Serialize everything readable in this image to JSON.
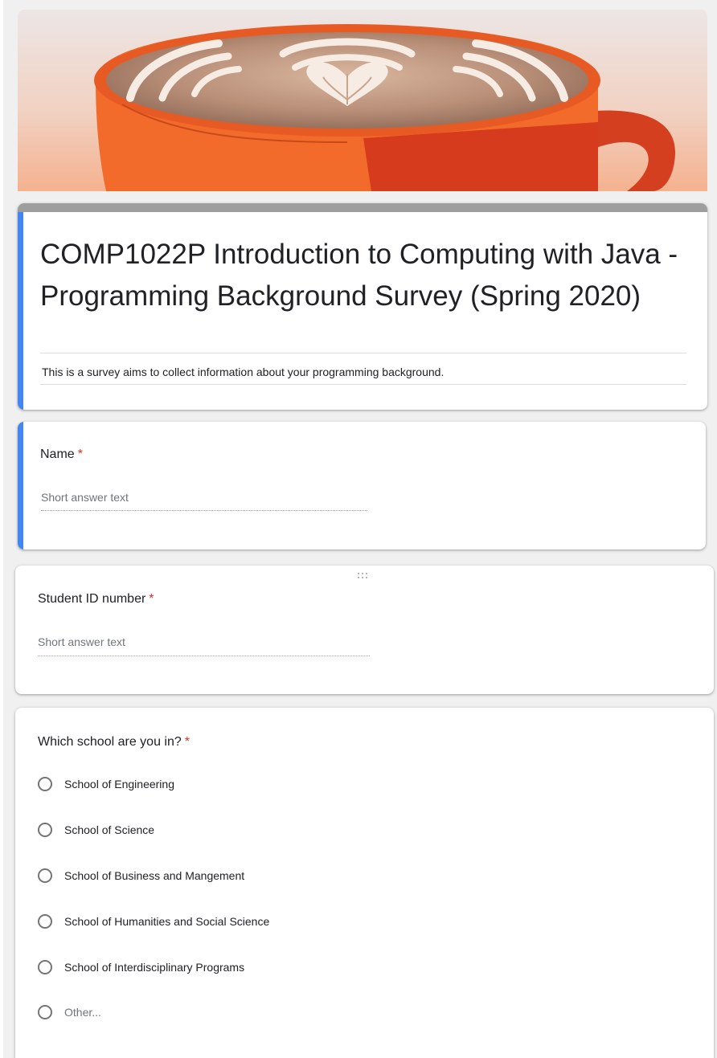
{
  "form": {
    "title": "COMP1022P Introduction to Computing with Java - Programming Background Survey (Spring 2020)",
    "description": "This is a survey aims to collect information about your programming background."
  },
  "questions": {
    "name": {
      "title": "Name",
      "required_mark": "*",
      "placeholder": "Short answer text"
    },
    "student_id": {
      "title": "Student ID number",
      "required_mark": "*",
      "placeholder": "Short answer text"
    },
    "school": {
      "title": "Which school are you in?",
      "required_mark": "*",
      "options": [
        "School of Engineering",
        "School of Science",
        "School of Business and Mangement",
        "School of Humanities and Social Science",
        "School of Interdisciplinary Programs",
        "Other..."
      ]
    }
  },
  "colors": {
    "accent": "#4285f4",
    "header_band": "#9e9e9e",
    "required": "#d93025",
    "cup": "#f26b2a"
  },
  "icons": {
    "header_image": "coffee-cup-latte-art",
    "drag_handle": "drag-handle-icon"
  }
}
